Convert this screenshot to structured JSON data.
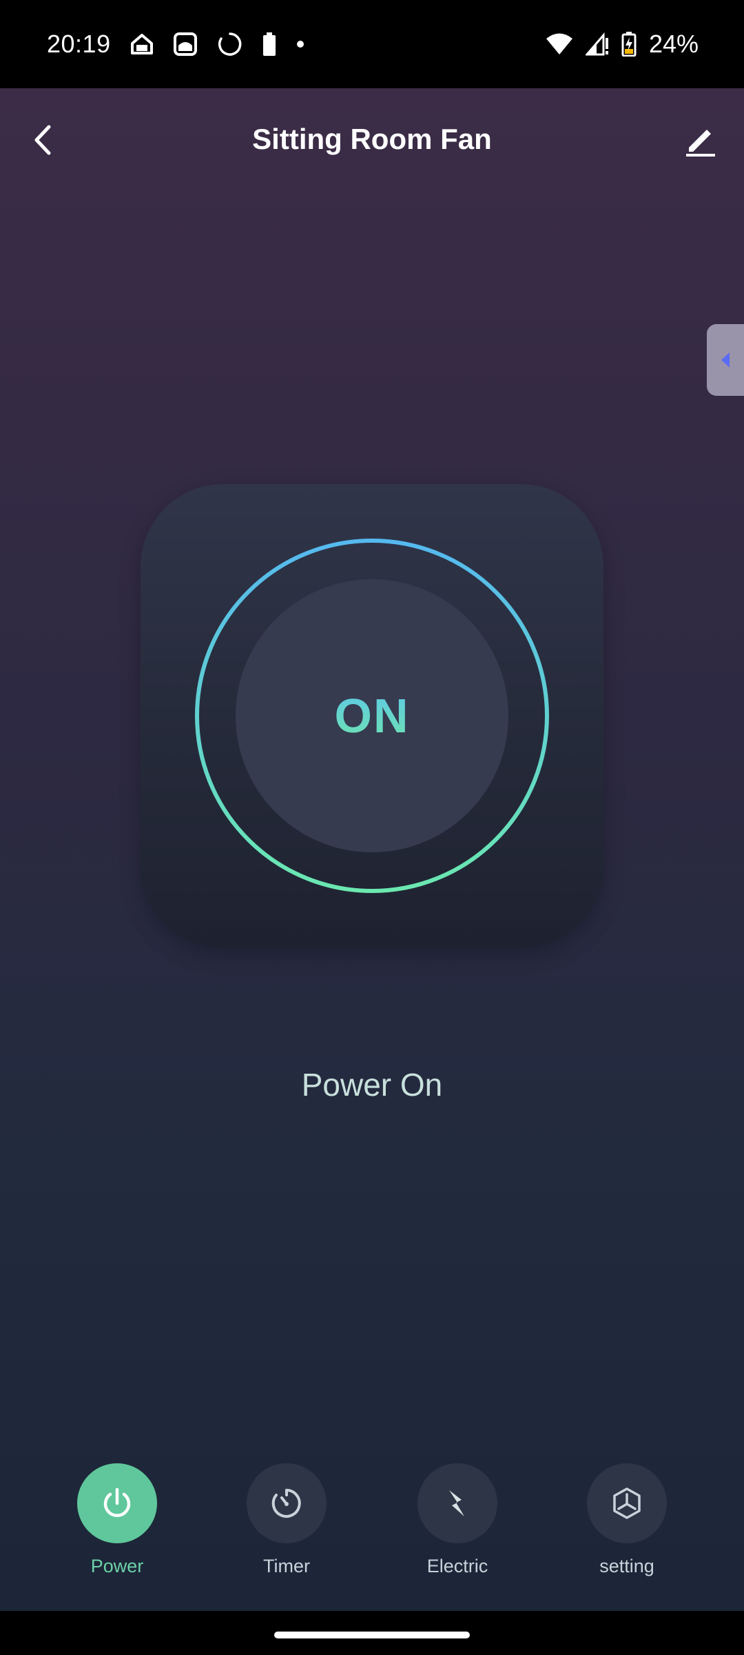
{
  "status_bar": {
    "time": "20:19",
    "battery_percent": "24%",
    "icons": [
      "home-icon",
      "photo-icon",
      "loading-icon",
      "battery-small-icon",
      "dot-icon",
      "wifi-icon",
      "signal-icon",
      "battery-charging-icon"
    ]
  },
  "header": {
    "title": "Sitting Room Fan",
    "back_icon": "back-chevron-icon",
    "edit_icon": "edit-pencil-icon"
  },
  "power_control": {
    "label": "ON",
    "status_text": "Power On",
    "ring_gradient": [
      "#55b9ef",
      "#6be8b0"
    ]
  },
  "actions": [
    {
      "label": "Power",
      "icon": "power-icon",
      "active": true
    },
    {
      "label": "Timer",
      "icon": "timer-icon",
      "active": false
    },
    {
      "label": "Electric",
      "icon": "lightning-icon",
      "active": false
    },
    {
      "label": "setting",
      "icon": "cube-icon",
      "active": false
    }
  ],
  "colors": {
    "accent": "#5fc79b",
    "side_tab": "#9a94ab",
    "side_tab_arrow": "#5b6cf2"
  }
}
